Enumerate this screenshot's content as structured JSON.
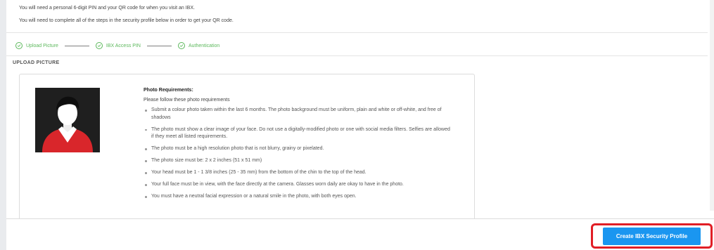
{
  "intro": {
    "line1": "You will need a personal 6-digit PIN and your QR code for when you visit an IBX.",
    "line2": "You will need to complete all of the steps in the security profile below in order to get your QR code."
  },
  "steps": [
    {
      "label": "Upload Picture",
      "completed": true
    },
    {
      "label": "IBX Access PIN",
      "completed": true
    },
    {
      "label": "Authentication",
      "completed": true
    }
  ],
  "section": {
    "title": "UPLOAD PICTURE"
  },
  "requirements": {
    "title": "Photo Requirements:",
    "intro": "Please follow these photo requirements",
    "items": [
      "Submit a colour photo taken within the last 6 months. The photo background must be uniform, plain and white or off-white, and free of shadows",
      "The photo must show a clear image of your face. Do not use a digitally-modified photo or one with social media filters. Selfies are allowed if they meet all listed requirements.",
      "The photo must be a high resolution photo that is not blurry, grainy or pixelated.",
      "The photo size must be: 2 x 2 inches (51 x 51 mm)",
      "Your head must be 1 - 1 3/8 inches (25 - 35 mm) from the bottom of the chin to the top of the head.",
      "Your full face must be in view, with the face directly at the camera. Glasses worn daily are okay to have in the photo.",
      "You must have a neutral facial expression or a natural smile in the photo, with both eyes open."
    ]
  },
  "footer": {
    "primary_label": "Create IBX Security Profile"
  },
  "colors": {
    "accent": "#1a96f0",
    "success": "#5cb85c",
    "highlight": "#e11e26"
  },
  "icons": {
    "step": "check-circle-icon",
    "avatar": "person-silhouette-icon"
  }
}
